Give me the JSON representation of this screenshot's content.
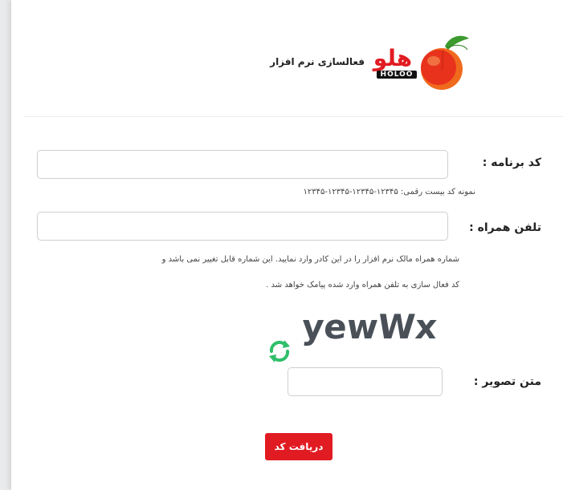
{
  "brand": {
    "name": "هلو",
    "latin": "HOLOO",
    "tagline": "فعالسازی نرم افزار"
  },
  "form": {
    "program_code": {
      "label": "کد برنامه :",
      "value": "",
      "hint": "نمونه کد بیست رقمی: ۱۲۳۴۵-۱۲۳۴۵-۱۲۳۴۵-۱۲۳۴۵"
    },
    "mobile": {
      "label": "تلفن همراه :",
      "value": "",
      "hint_line1": "شماره همراه مالک نرم افزار را در این کادر وارد نمایید. این شماره قابل تغییر نمی باشد و",
      "hint_line2": "کد فعال سازی به تلفن همراه وارد شده پیامک خواهد شد ."
    },
    "captcha": {
      "image_text": "yewWx",
      "label": "متن تصویر :",
      "value": ""
    },
    "submit_label": "دریافت کد"
  },
  "colors": {
    "accent": "#e11b22",
    "refresh": "#2fbf6a"
  },
  "icons": {
    "logo": "peach-icon",
    "refresh": "refresh-icon"
  }
}
